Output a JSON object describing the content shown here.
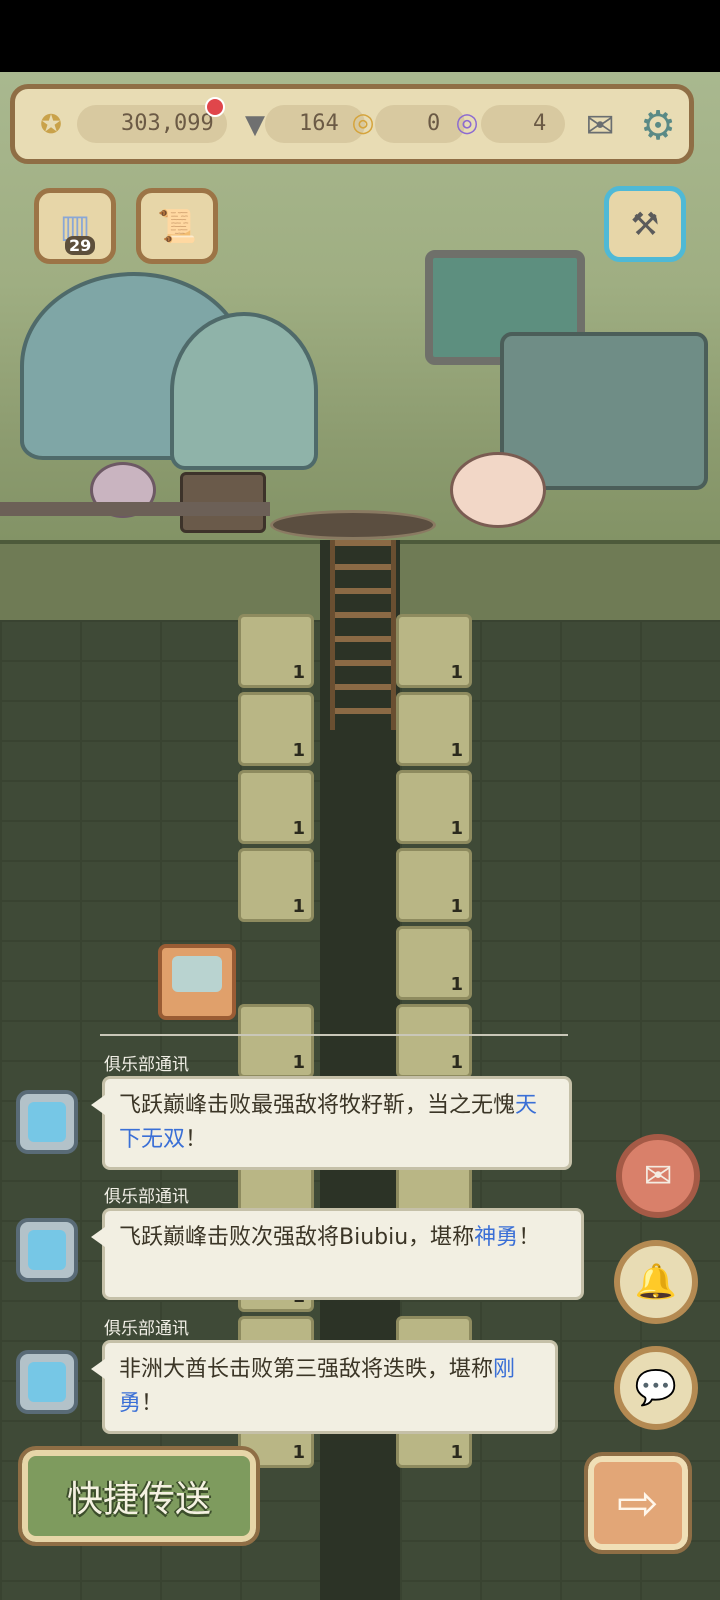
{
  "resources": {
    "coins": "303,099",
    "drill_bits": "164",
    "gold_token": "0",
    "purple_token": "4"
  },
  "level_badge": "29",
  "blocks": {
    "left": [
      "1",
      "1",
      "1",
      "1",
      "1",
      "1",
      "1",
      "1",
      "1"
    ],
    "right": [
      "1",
      "1",
      "1",
      "1",
      "1",
      "1",
      "1",
      "1",
      "1"
    ]
  },
  "chat": [
    {
      "sender": "俱乐部通讯",
      "text": "飞跃巅峰击败最强敌将牧籽靳，当之无愧",
      "highlight": "天下无双",
      "tail": "！"
    },
    {
      "sender": "俱乐部通讯",
      "text": "飞跃巅峰击败次强敌将Biubiu，堪称",
      "highlight": "神勇",
      "tail": "！"
    },
    {
      "sender": "俱乐部通讯",
      "text": "非洲大酋长击败第三强敌将迭昳，堪称",
      "highlight": "刚勇",
      "tail": "！"
    }
  ],
  "buttons": {
    "teleport_label": "快捷传送",
    "next_arrow": "⇨"
  },
  "icons": {
    "coin": "star-medal-icon",
    "drill": "drill-icon",
    "gold_token": "gold-shell-token-icon",
    "purple_token": "purple-shell-token-icon",
    "mail": "mail-icon",
    "settings": "gear-icon",
    "level": "level-icon",
    "quest": "scroll-icon",
    "tool": "hammer-icon",
    "mail_round": "mail-icon",
    "bell": "bell-icon",
    "chat": "chat-bubble-icon"
  },
  "colors": {
    "highlight": "#3a6fd6",
    "notification_dot": "#e0464b"
  }
}
